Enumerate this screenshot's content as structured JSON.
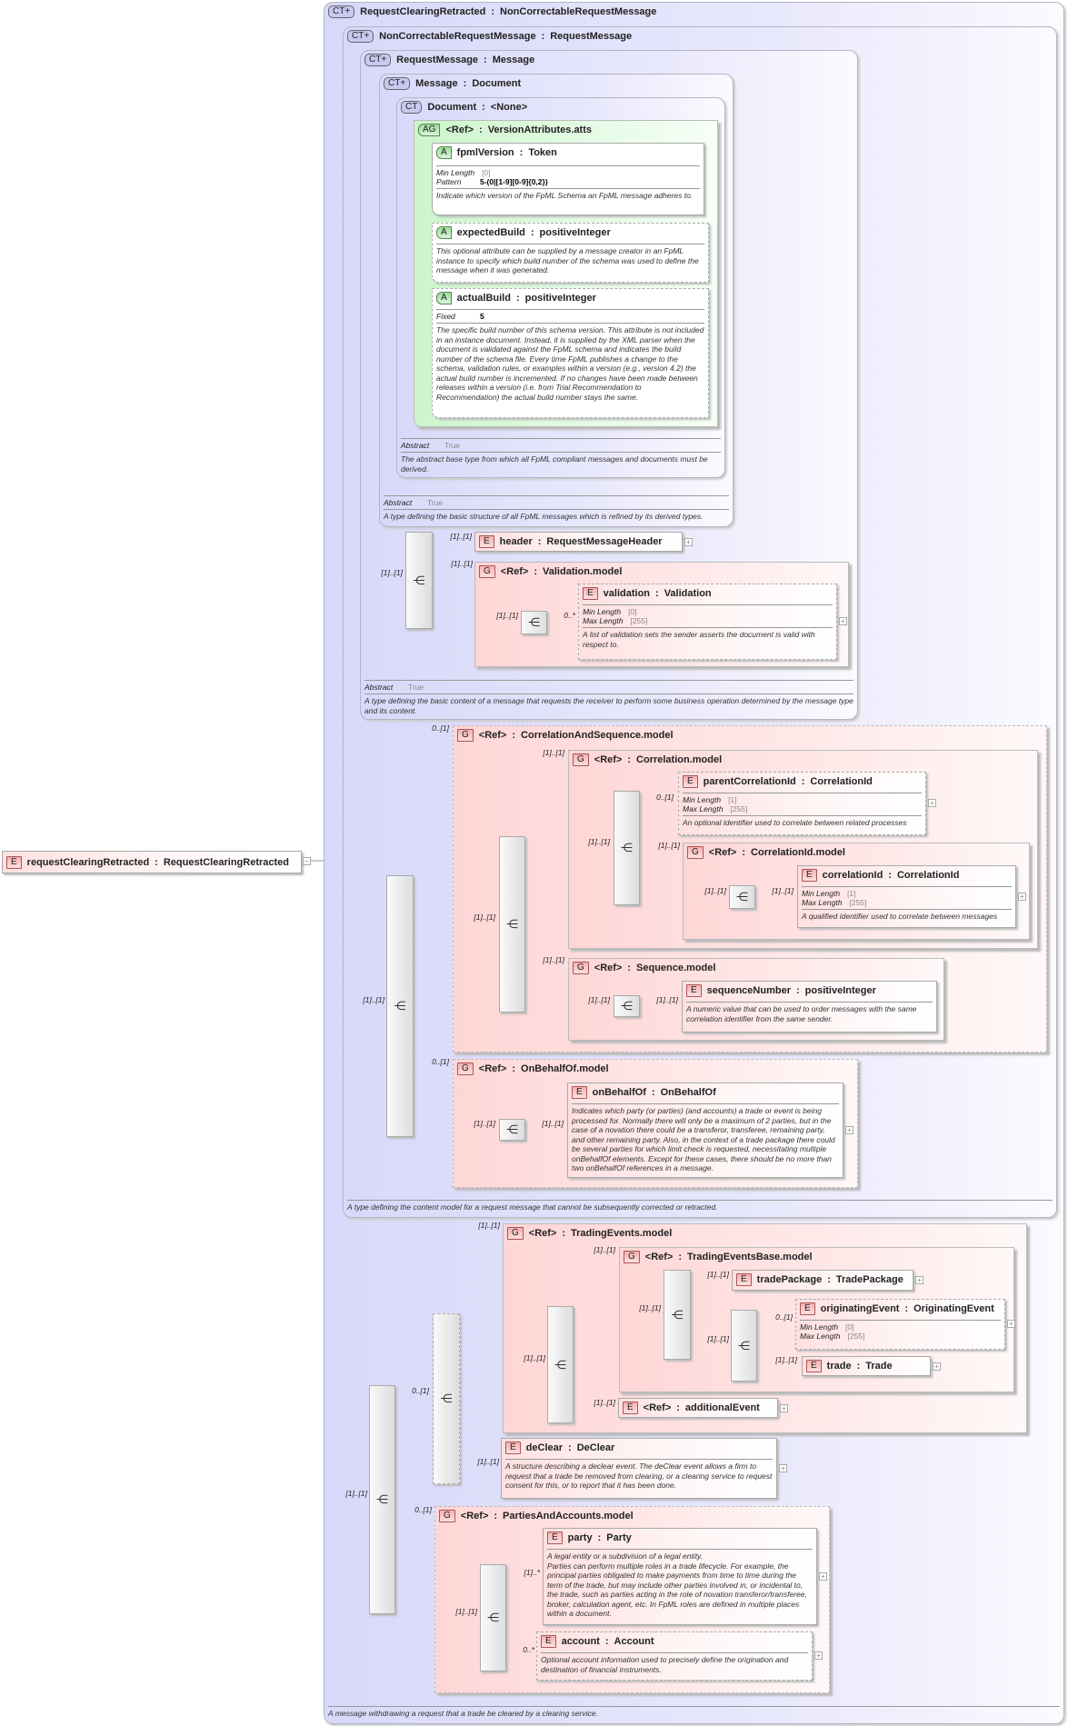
{
  "root": {
    "badge": "E",
    "name": "requestClearingRetracted",
    "type": "RequestClearingRetracted",
    "toggle": "−"
  },
  "nodes": {
    "ct_rcr": {
      "badge": "CT+",
      "name": "RequestClearingRetracted",
      "type": "NonCorrectableRequestMessage",
      "description": "A message withdrawing a request that a trade be cleared by a clearing service."
    },
    "ct_ncrm": {
      "badge": "CT+",
      "name": "NonCorrectableRequestMessage",
      "type": "RequestMessage",
      "description": "A type defining the content model for a request message that cannot be subsequently corrected or retracted."
    },
    "ct_rm": {
      "badge": "CT+",
      "name": "RequestMessage",
      "type": "Message",
      "facets": [
        {
          "label": "Abstract",
          "value": "True"
        }
      ],
      "description": "A type defining the basic content of a message that requests the receiver to perform some business operation determined by the message type and its content."
    },
    "ct_msg": {
      "badge": "CT+",
      "name": "Message",
      "type": "Document",
      "facets": [
        {
          "label": "Abstract",
          "value": "True"
        }
      ],
      "description": "A type defining the basic structure of all FpML messages which is refined by its derived types."
    },
    "ct_doc": {
      "badge": "CT",
      "name": "Document",
      "type": "<None>",
      "facets": [
        {
          "label": "Abstract",
          "value": "True"
        }
      ],
      "description": "The abstract base type from which all FpML compliant messages and documents must be derived."
    },
    "ag": {
      "badge": "AG",
      "name": "<Ref>",
      "type": "VersionAttributes.atts"
    },
    "a_fpml": {
      "badge": "A",
      "name": "fpmlVersion",
      "type": "Token",
      "facets": [
        {
          "label": "Min Length",
          "value": "[0]"
        },
        {
          "label": "Pattern",
          "value": "5-(0|[1-9][0-9]{0,2})",
          "bold": true
        }
      ],
      "description": "Indicate which version of the FpML Schema an FpML message adheres to."
    },
    "a_exp": {
      "badge": "A",
      "name": "expectedBuild",
      "type": "positiveInteger",
      "description": "This optional attribute can be supplied by a message creator in an FpML instance to specify which build number of the schema was used to define the message when it was generated."
    },
    "a_act": {
      "badge": "A",
      "name": "actualBuild",
      "type": "positiveInteger",
      "facets": [
        {
          "label": "Fixed",
          "value": "5",
          "bold": true
        }
      ],
      "description": "The specific build number of this schema version. This attribute is not included in an instance document. Instead, it is supplied by the XML parser when the document is validated against the FpML schema and indicates the build number of the schema file. Every time FpML publishes a change to the schema, validation rules, or examples within a version (e.g., version 4.2) the actual build number is incremented. If no changes have been made between releases within a version (i.e. from Trial Recommendation to Recommendation) the actual build number stays the same."
    },
    "e_header": {
      "badge": "E",
      "name": "header",
      "type": "RequestMessageHeader"
    },
    "g_val": {
      "badge": "G",
      "name": "<Ref>",
      "type": "Validation.model"
    },
    "e_validation": {
      "badge": "E",
      "name": "validation",
      "type": "Validation",
      "facets": [
        {
          "label": "Min Length",
          "value": "[0]"
        },
        {
          "label": "Max Length",
          "value": "[255]"
        }
      ],
      "description": "A list of validation sets the sender asserts the document is valid with respect to."
    },
    "g_cas": {
      "badge": "G",
      "name": "<Ref>",
      "type": "CorrelationAndSequence.model"
    },
    "g_corr": {
      "badge": "G",
      "name": "<Ref>",
      "type": "Correlation.model"
    },
    "e_pcid": {
      "badge": "E",
      "name": "parentCorrelationId",
      "type": "CorrelationId",
      "facets": [
        {
          "label": "Min Length",
          "value": "[1]"
        },
        {
          "label": "Max Length",
          "value": "[255]"
        }
      ],
      "description": "An optional identifier used to correlate between related processes"
    },
    "g_cidm": {
      "badge": "G",
      "name": "<Ref>",
      "type": "CorrelationId.model"
    },
    "e_cid": {
      "badge": "E",
      "name": "correlationId",
      "type": "CorrelationId",
      "facets": [
        {
          "label": "Min Length",
          "value": "[1]"
        },
        {
          "label": "Max Length",
          "value": "[255]"
        }
      ],
      "description": "A qualified identifier used to correlate between messages"
    },
    "g_seq": {
      "badge": "G",
      "name": "<Ref>",
      "type": "Sequence.model"
    },
    "e_seqnum": {
      "badge": "E",
      "name": "sequenceNumber",
      "type": "positiveInteger",
      "description": "A numeric value that can be used to order messages with the same correlation identifier from the same sender."
    },
    "g_obo": {
      "badge": "G",
      "name": "<Ref>",
      "type": "OnBehalfOf.model"
    },
    "e_obo": {
      "badge": "E",
      "name": "onBehalfOf",
      "type": "OnBehalfOf",
      "description": "Indicates which party (or parties) (and accounts) a trade or event is being processed for. Normally there will only be a maximum of 2 parties, but in the case of a novation there could be a transferor, transferee, remaining party, and other remaining party. Also, in the context of a trade package there could be several parties for which limit check is requested, necessitating multiple onBehalfOf elements. Except for these cases, there should be no more than two onBehalfOf references in a message."
    },
    "g_te": {
      "badge": "G",
      "name": "<Ref>",
      "type": "TradingEvents.model"
    },
    "g_teb": {
      "badge": "G",
      "name": "<Ref>",
      "type": "TradingEventsBase.model"
    },
    "e_tp": {
      "badge": "E",
      "name": "tradePackage",
      "type": "TradePackage"
    },
    "e_oe": {
      "badge": "E",
      "name": "originatingEvent",
      "type": "OriginatingEvent",
      "facets": [
        {
          "label": "Min Length",
          "value": "[0]"
        },
        {
          "label": "Max Length",
          "value": "[255]"
        }
      ]
    },
    "e_trade": {
      "badge": "E",
      "name": "trade",
      "type": "Trade"
    },
    "e_add": {
      "badge": "E",
      "name": "<Ref>",
      "type": "additionalEvent"
    },
    "e_dc": {
      "badge": "E",
      "name": "deClear",
      "type": "DeClear",
      "description": "A structure describing a declear event. The deClear event allows a firm to request that a trade be removed from clearing, or a clearing service to request consent for this, or to report that it has been done."
    },
    "g_paa": {
      "badge": "G",
      "name": "<Ref>",
      "type": "PartiesAndAccounts.model"
    },
    "e_party": {
      "badge": "E",
      "name": "party",
      "type": "Party",
      "description": "A legal entity or a subdivision of a legal entity.\nParties can perform multiple roles in a trade lifecycle. For example, the principal parties obligated to make payments from time to time during the term of the trade, but may include other parties involved in, or incidental to, the trade, such as parties acting in the role of novation transferor/transferee, broker, calculation agent, etc. In FpML roles are defined in multiple places within a document."
    },
    "e_acct": {
      "badge": "E",
      "name": "account",
      "type": "Account",
      "description": "Optional account information used to precisely define the origination and destination of financial instruments."
    }
  },
  "cardinalities": [
    "[1]..[1]",
    "[1]..[1]",
    "[1]..[1]",
    "[1]..[1]",
    "0..*",
    "0..[1]",
    "[1]..[1]",
    "[1]..[1]",
    "0..[1]",
    "[1]..[1]",
    "[1]..[1]",
    "[1]..[1]",
    "[1]..[1]",
    "[1]..[1]",
    "[1]..[1]",
    "[1]..[1]",
    "[1]..[1]",
    "0..[1]",
    "[1]..[1]",
    "[1]..[1]",
    "[1]..[1]",
    "[1]..[1]",
    "[1]..[1]",
    "[1]..[1]",
    "0..[1]",
    "[1]..[1]",
    "[1]..[1]",
    "[1]..[1]",
    "[1]..[1]",
    "0..[1]",
    "[1]..[1]",
    "[1]..[1]",
    "0..[1]",
    "[1]..*",
    "[1]..[1]",
    "0..*"
  ],
  "expand_symbol": "+",
  "sequence_icon": "sequence-compositor-icon",
  "colors": {
    "complex_type": "#d8d8fa",
    "group": "#ffd6d6",
    "element": "#ffe0e0",
    "attribute_group": "#ccf5cc"
  }
}
